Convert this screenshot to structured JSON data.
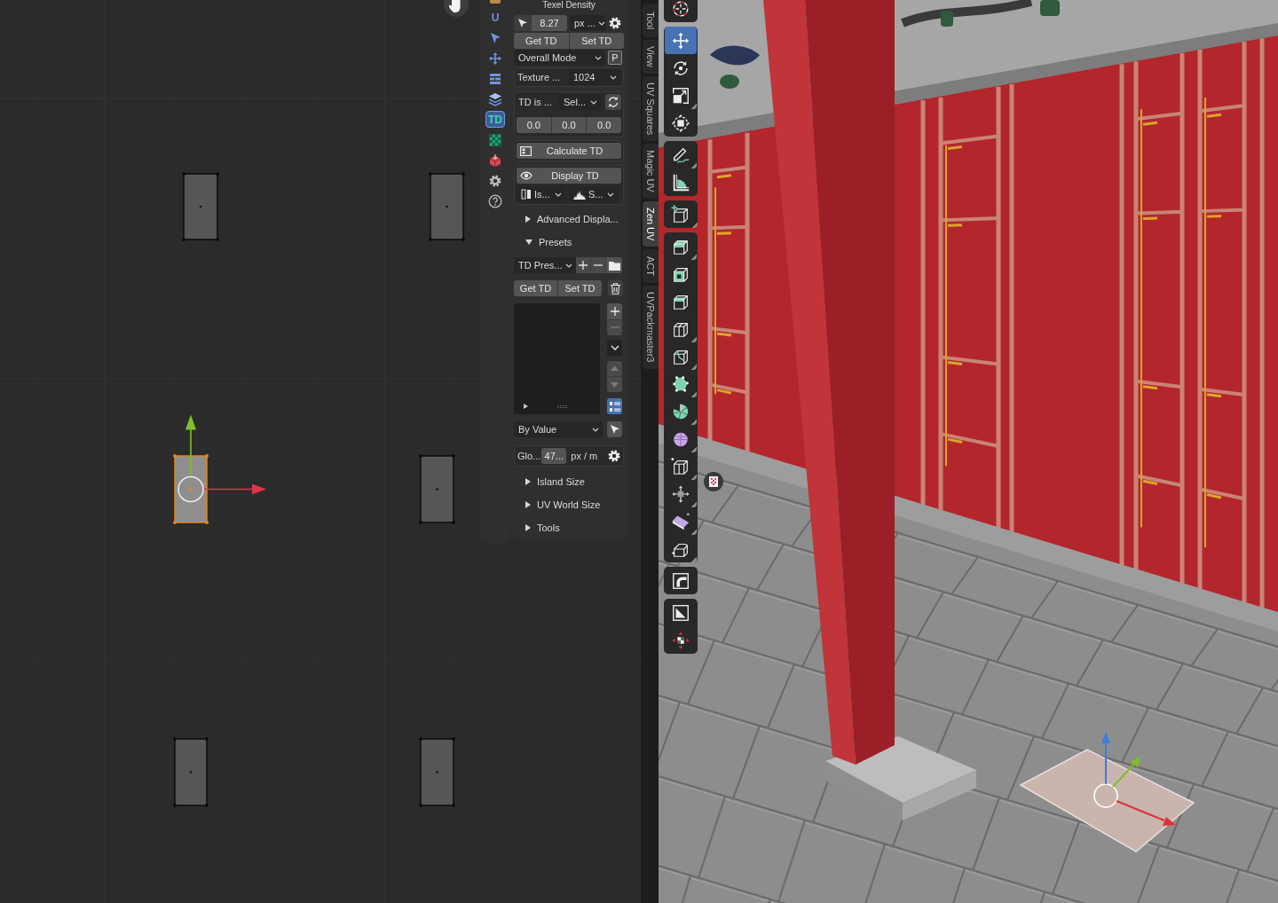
{
  "uv_editor": {
    "islands": [
      {
        "selected": false
      },
      {
        "selected": false
      },
      {
        "selected": true
      },
      {
        "selected": false
      },
      {
        "selected": false
      },
      {
        "selected": false
      }
    ]
  },
  "addon_tabs": [
    {
      "kind": "clipped",
      "selected": false
    },
    {
      "kind": "logo",
      "glyph": "U",
      "selected": false
    },
    {
      "kind": "select",
      "selected": false
    },
    {
      "kind": "transform",
      "selected": false
    },
    {
      "kind": "stack",
      "selected": false
    },
    {
      "kind": "layers",
      "selected": false
    },
    {
      "kind": "texel",
      "glyph": "TD",
      "selected": true
    },
    {
      "kind": "checker",
      "selected": false
    },
    {
      "kind": "pack",
      "selected": false
    },
    {
      "kind": "preferences",
      "selected": false
    },
    {
      "kind": "help",
      "selected": false
    }
  ],
  "panel": {
    "title": "Texel Density",
    "density": {
      "value": "8.27",
      "unit": "px ..."
    },
    "get_set": [
      "Get TD",
      "Set TD"
    ],
    "mode": {
      "value": "Overall Mode",
      "pin": {
        "label": "P",
        "on": false
      }
    },
    "texture": {
      "label": "Texture ...",
      "value": "1024"
    },
    "td_is": {
      "label": "TD is ...",
      "value": "Sel...",
      "values": [
        "0.0",
        "0.0",
        "0.0"
      ]
    },
    "calculate": "Calculate TD",
    "display": {
      "label": "Display TD",
      "mode": "Is...",
      "scheme": "S..."
    },
    "advanced": {
      "label": "Advanced Displa...",
      "expanded": false
    },
    "presets": {
      "label": "Presets",
      "expanded": true,
      "preset": "TD Pres...",
      "buttons": [
        "Get TD",
        "Set TD"
      ],
      "list_controls": [
        {
          "kind": "add",
          "disabled": false,
          "on": false
        },
        {
          "kind": "remove",
          "disabled": true,
          "on": false
        },
        {
          "kind": "menu",
          "disabled": false,
          "on": false
        },
        {
          "kind": "up",
          "disabled": true,
          "on": false
        },
        {
          "kind": "down",
          "disabled": true,
          "on": false
        },
        {
          "kind": "sort",
          "disabled": false,
          "on": true
        }
      ],
      "sort_by": "By Value",
      "global": {
        "label": "Glo...",
        "value": "47...",
        "unit": "px / m"
      }
    },
    "subpanels": [
      {
        "label": "Island Size",
        "expanded": false
      },
      {
        "label": "UV World Size",
        "expanded": false
      },
      {
        "label": "Tools",
        "expanded": false
      }
    ]
  },
  "sidebar_tabs": [
    {
      "label": "Tool",
      "selected": false
    },
    {
      "label": "View",
      "selected": false
    },
    {
      "label": "UV Squares",
      "selected": false
    },
    {
      "label": "Magic UV",
      "selected": false
    },
    {
      "label": "Zen UV",
      "selected": true
    },
    {
      "label": "ACT",
      "selected": false
    },
    {
      "label": "UVPackmaster3",
      "selected": false
    }
  ],
  "toolbar": [
    {
      "tools": [
        {
          "kind": "cursor",
          "selected": false,
          "more": false
        }
      ]
    },
    {
      "tools": [
        {
          "kind": "move",
          "selected": true,
          "more": false
        },
        {
          "kind": "rotate",
          "selected": false,
          "more": false
        },
        {
          "kind": "scale",
          "selected": false,
          "more": true
        },
        {
          "kind": "transform",
          "selected": false,
          "more": false
        }
      ]
    },
    {
      "tools": [
        {
          "kind": "annotate",
          "selected": false,
          "more": true
        },
        {
          "kind": "measure",
          "selected": false,
          "more": false
        }
      ]
    },
    {
      "tools": [
        {
          "kind": "add_cube",
          "selected": false,
          "more": true
        }
      ]
    },
    {
      "tools": [
        {
          "kind": "extrude",
          "selected": false,
          "more": true
        },
        {
          "kind": "inset",
          "selected": false,
          "more": false
        },
        {
          "kind": "bevel",
          "selected": false,
          "more": false
        },
        {
          "kind": "loop_cut",
          "selected": false,
          "more": true
        },
        {
          "kind": "knife",
          "selected": false,
          "more": true
        },
        {
          "kind": "poly_build",
          "selected": false,
          "more": true
        },
        {
          "kind": "spin",
          "selected": false,
          "more": true
        },
        {
          "kind": "smooth",
          "selected": false,
          "more": true
        },
        {
          "kind": "edge_slide",
          "selected": false,
          "more": true
        },
        {
          "kind": "shrink",
          "selected": false,
          "more": true
        },
        {
          "kind": "shear",
          "selected": false,
          "more": true
        },
        {
          "kind": "rip",
          "selected": false,
          "more": true
        }
      ]
    },
    {
      "tools": [
        {
          "kind": "corner",
          "selected": false,
          "more": false
        }
      ]
    },
    {
      "tools": [
        {
          "kind": "split",
          "selected": false,
          "more": false
        },
        {
          "kind": "checker_move",
          "selected": false,
          "more": false
        }
      ]
    }
  ]
}
